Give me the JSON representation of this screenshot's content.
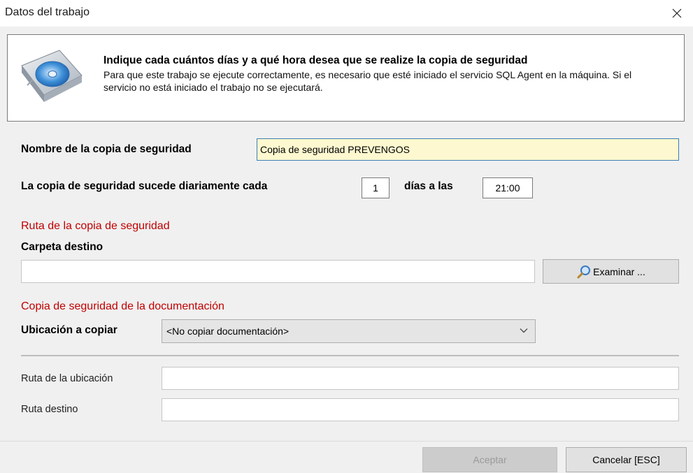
{
  "window": {
    "title": "Datos del trabajo",
    "close_glyph": "×"
  },
  "header": {
    "icon": "backup-disk-icon",
    "title": "Indique cada cuántos días y a qué hora desea que se realize la copia de seguridad",
    "description": "Para que este trabajo se ejecute correctamente, es necesario que esté iniciado el servicio SQL Agent en la máquina. Si el servicio no está iniciado el trabajo no se ejecutará."
  },
  "form": {
    "backup_name_label": "Nombre de la copia de seguridad",
    "backup_name_value": "Copia de seguridad PREVENGOS",
    "schedule_label": "La copia de seguridad sucede diariamente cada",
    "days_value": "1",
    "days_suffix_label": "días a las",
    "time_value": "21:00"
  },
  "backup_path": {
    "section_title": "Ruta de la copia de seguridad",
    "folder_label": "Carpeta destino",
    "folder_value": "",
    "browse_label": "Examinar ..."
  },
  "documentation": {
    "section_title": "Copia de seguridad de la documentación",
    "location_label": "Ubicación a copiar",
    "location_selected": "<No copiar documentación>",
    "location_path_label": "Ruta de la ubicación",
    "location_path_value": "",
    "destination_path_label": "Ruta destino",
    "destination_path_value": ""
  },
  "footer": {
    "accept_label": "Aceptar",
    "cancel_label": "Cancelar [ESC]"
  },
  "colors": {
    "section_title": "#c00000",
    "focused_input_bg": "#fdf8cf"
  }
}
